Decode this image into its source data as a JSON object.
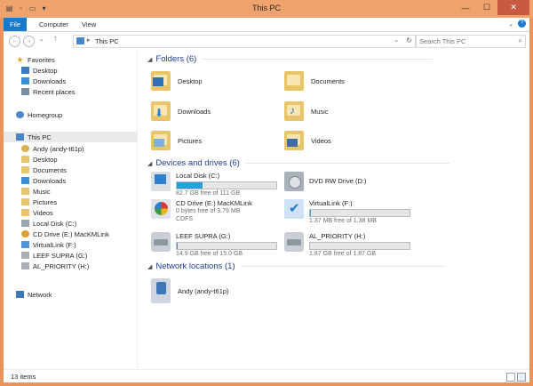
{
  "window": {
    "title": "This PC"
  },
  "quick_access": [
    "drive-icon",
    "properties-icon",
    "new-folder-icon",
    "customize-arrow-icon"
  ],
  "window_controls": {
    "minimize": "—",
    "maximize": "☐",
    "close": "✕"
  },
  "ribbon": {
    "tabs": [
      "File",
      "Computer",
      "View"
    ],
    "toggle": "⌄",
    "help": "?"
  },
  "address_bar": {
    "back": "←",
    "forward": "→",
    "recent": "⌄",
    "up": "↑",
    "separator": "▸",
    "path": "This PC",
    "dropdown": "⌄",
    "refresh": "↻"
  },
  "search": {
    "placeholder": "Search This PC",
    "icon": "⌕"
  },
  "nav": {
    "favorites": "Favorites",
    "desktop": "Desktop",
    "downloads": "Downloads",
    "recent_places": "Recent places",
    "homegroup": "Homegroup",
    "this_pc": "This PC",
    "andy": "Andy (andy-t61p)",
    "pc_desktop": "Desktop",
    "pc_documents": "Documents",
    "pc_downloads": "Downloads",
    "pc_music": "Music",
    "pc_pictures": "Pictures",
    "pc_videos": "Videos",
    "local_disk": "Local Disk (C:)",
    "cd_drive": "CD Drive (E:) MacKMLink",
    "virtuallink": "VirtualLink (F:)",
    "leef": "LEEF SUPRA (G:)",
    "al_priority": "AL_PRIORITY (H:)",
    "network": "Network"
  },
  "groups": {
    "folders": "Folders (6)",
    "devices": "Devices and drives (6)",
    "network": "Network locations (1)"
  },
  "folders": {
    "desktop": "Desktop",
    "documents": "Documents",
    "downloads": "Downloads",
    "music": "Music",
    "pictures": "Pictures",
    "videos": "Videos"
  },
  "drives": {
    "c": {
      "name": "Local Disk (C:)",
      "free": "82.7 GB free of 111 GB",
      "used_fraction": 0.255
    },
    "d": {
      "name": "DVD RW Drive (D:)"
    },
    "e": {
      "name": "CD Drive (E:) MacKMLink",
      "free": "0 bytes free of 3.79 MB",
      "fs": "CDFS"
    },
    "f": {
      "name": "VirtualLink (F:)",
      "free": "1.37 MB free of 1.38 MB",
      "used_fraction": 0.007
    },
    "g": {
      "name": "LEEF SUPRA (G:)",
      "free": "14.9 GB free of 15.0 GB",
      "used_fraction": 0.007
    },
    "h": {
      "name": "AL_PRIORITY (H:)",
      "free": "1.87 GB free of 1.87 GB",
      "used_fraction": 0.0
    }
  },
  "network_locations": {
    "andy": "Andy (andy-t61p)"
  },
  "status": {
    "count": "13 items"
  }
}
